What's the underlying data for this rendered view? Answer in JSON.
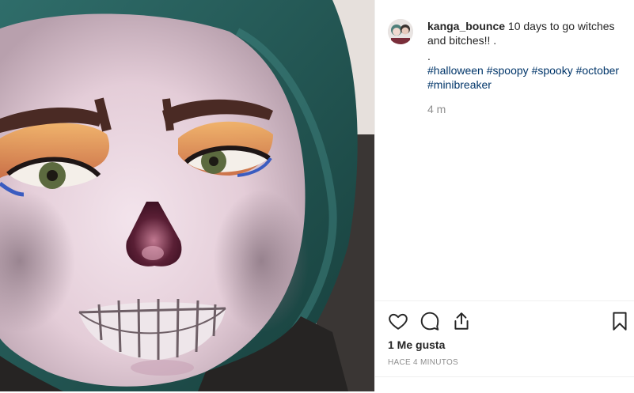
{
  "post": {
    "username": "kanga_bounce",
    "caption": "10 days to go witches and bitches!! .",
    "caption_dot": ".",
    "hashtags": [
      "#halloween",
      "#spoopy",
      "#spooky",
      "#october",
      "#minibreaker"
    ],
    "age": "4 m",
    "likes": "1 Me gusta",
    "time_ago": "HACE 4 MINUTOS"
  },
  "icons": {
    "like": "heart-icon",
    "comment": "comment-icon",
    "share": "share-icon",
    "save": "bookmark-icon"
  },
  "colors": {
    "hashtag": "#003569",
    "muted": "#8e8e8e",
    "text": "#262626",
    "divider": "#efefef"
  }
}
